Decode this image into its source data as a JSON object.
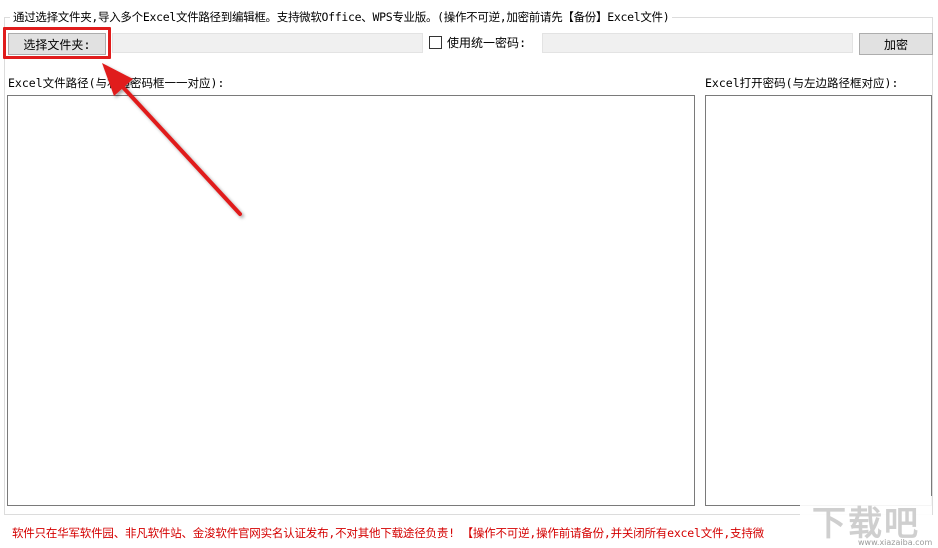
{
  "group_box": {
    "title": "通过选择文件夹,导入多个Excel文件路径到编辑框。支持微软Office、WPS专业版。(操作不可逆,加密前请先【备份】Excel文件)"
  },
  "toolbar": {
    "select_folder_button": "选择文件夹:",
    "folder_path_value": "",
    "unified_password_checked": false,
    "unified_password_label": "使用统一密码:",
    "unified_password_value": "",
    "encrypt_button": "加密"
  },
  "panels": {
    "left_label": "Excel文件路径(与右边密码框一一对应):",
    "left_content": "",
    "right_label": "Excel打开密码(与左边路径框对应):",
    "right_content": ""
  },
  "footer": {
    "notice": "软件只在华军软件园、非凡软件站、金浚软件官网实名认证发布,不对其他下载途径负责! 【操作不可逆,操作前请备份,并关闭所有excel文件,支持微"
  },
  "watermark": {
    "logo_text": "下载吧",
    "url_text": "www.xiazaiba.com"
  },
  "colors": {
    "highlight": "#e01c1c",
    "notice": "#d40000",
    "button_face": "#e1e1e1"
  }
}
